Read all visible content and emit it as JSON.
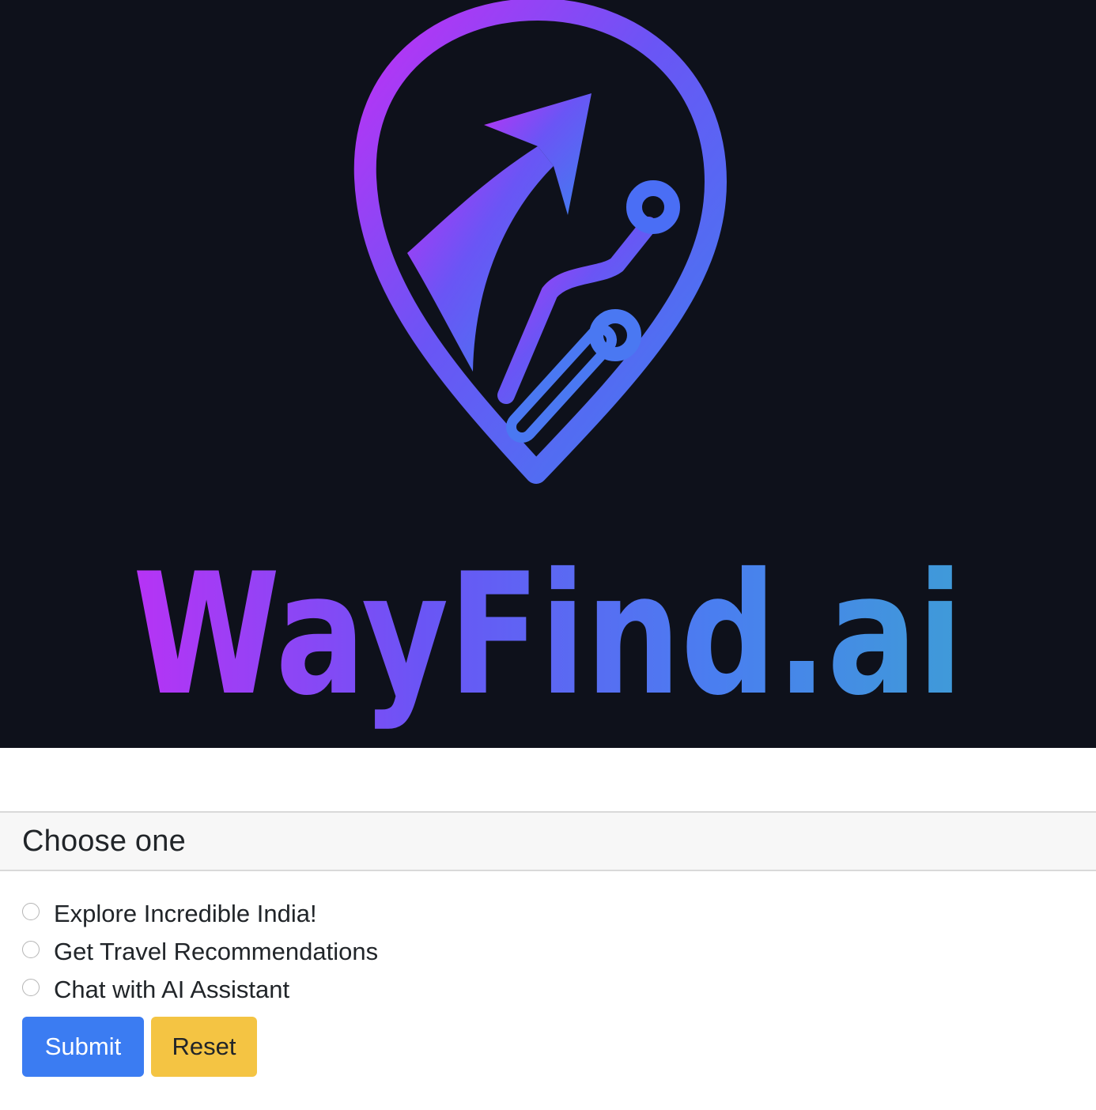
{
  "hero": {
    "brand_name": "WayFind.ai",
    "logo_icon": "map-pin-route-icon",
    "background_color": "#0e111b",
    "gradient_start": "#b733f5",
    "gradient_mid": "#5b5ef5",
    "gradient_end": "#3f9bd8"
  },
  "form": {
    "header": "Choose one",
    "options": [
      {
        "label": "Explore Incredible India!",
        "selected": false
      },
      {
        "label": "Get Travel Recommendations",
        "selected": false
      },
      {
        "label": "Chat with AI Assistant",
        "selected": false
      }
    ],
    "submit_label": "Submit",
    "reset_label": "Reset",
    "submit_color": "#3b7cf2",
    "reset_color": "#f4c443"
  }
}
